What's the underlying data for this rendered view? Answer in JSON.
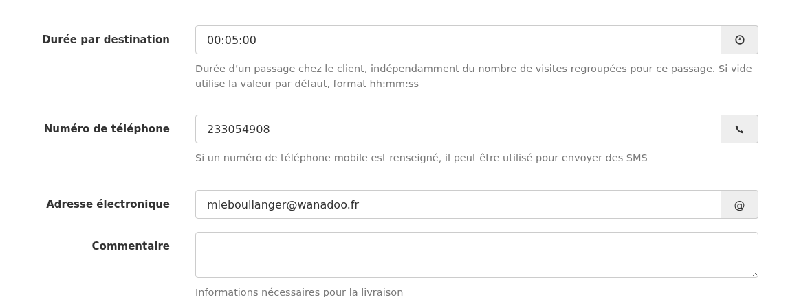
{
  "fields": [
    {
      "kind": "time",
      "label": "Durée par destination",
      "value": "00:05:00",
      "help": "Durée d’un passage chez le client, indépendamment du nombre de visites regroupées pour ce passage. Si vide utilise la valeur par défaut, format hh:mm:ss"
    },
    {
      "kind": "phone",
      "label": "Numéro de téléphone",
      "value": "233054908",
      "help": "Si un numéro de téléphone mobile est renseigné, il peut être utilisé pour envoyer des SMS"
    },
    {
      "kind": "email",
      "label": "Adresse électronique",
      "value": "mleboullanger@wanadoo.fr",
      "addon_text": "@"
    },
    {
      "kind": "textarea",
      "label": "Commentaire",
      "help": "Informations nécessaires pour la livraison"
    }
  ]
}
